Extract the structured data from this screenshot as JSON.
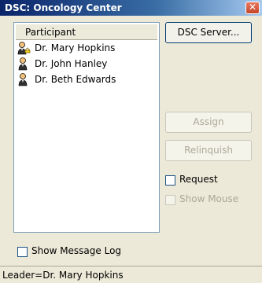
{
  "window": {
    "title": "DSC: Oncology Center",
    "close_glyph": "✕"
  },
  "participants": {
    "header": "Participant",
    "items": [
      {
        "name": "Dr. Mary Hopkins",
        "icon": "leader-person-icon"
      },
      {
        "name": "Dr. John Hanley",
        "icon": "person-icon"
      },
      {
        "name": "Dr. Beth Edwards",
        "icon": "person-icon"
      }
    ]
  },
  "buttons": {
    "dsc_server": "DSC Server...",
    "assign": "Assign",
    "relinquish": "Relinquish"
  },
  "options": {
    "request": "Request",
    "show_mouse": "Show Mouse",
    "show_message_log": "Show Message Log"
  },
  "status": {
    "text": "Leader=Dr. Mary Hopkins"
  }
}
